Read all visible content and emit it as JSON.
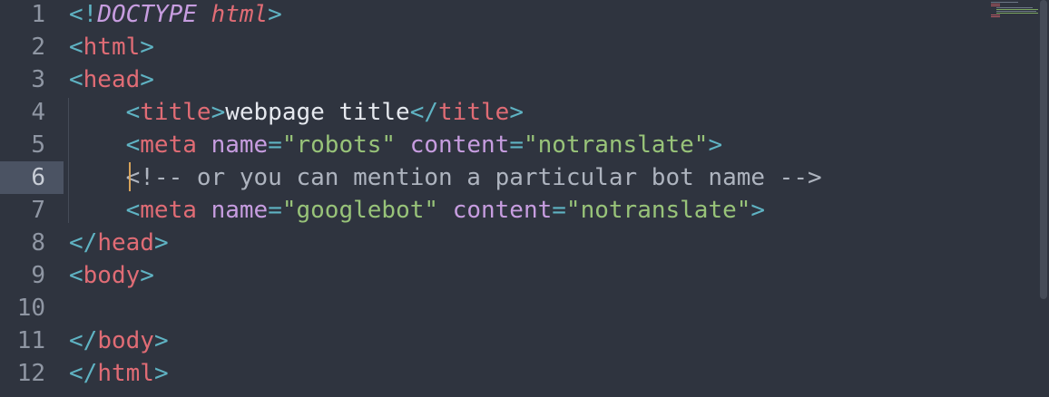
{
  "editor": {
    "active_line": 6,
    "line_numbers": [
      "1",
      "2",
      "3",
      "4",
      "5",
      "6",
      "7",
      "8",
      "9",
      "10",
      "11",
      "12"
    ],
    "colors": {
      "background": "#2f343f",
      "tag": "#e06c75",
      "punctuation": "#5fb3c3",
      "attribute": "#c79de0",
      "string": "#98c379",
      "text": "#e6e9ef",
      "comment": "#aeb4bf",
      "cursor": "#d7a35a"
    },
    "lines": [
      {
        "t1": "<!",
        "t2": "DOCTYPE",
        "t3": " ",
        "t4": "html",
        "t5": ">"
      },
      {
        "t1": "<",
        "t2": "html",
        "t3": ">"
      },
      {
        "t1": "<",
        "t2": "head",
        "t3": ">"
      },
      {
        "indent": "    ",
        "t1": "<",
        "t2": "title",
        "t3": ">",
        "t4": "webpage title",
        "t5": "</",
        "t6": "title",
        "t7": ">"
      },
      {
        "indent": "    ",
        "t1": "<",
        "t2": "meta",
        "t3": " ",
        "t4": "name",
        "t5": "=",
        "t6": "\"robots\"",
        "t7": " ",
        "t8": "content",
        "t9": "=",
        "t10": "\"notranslate\"",
        "t11": ">"
      },
      {
        "indent": "    ",
        "t1": "<!-- or you can mention a particular bot name -->"
      },
      {
        "indent": "    ",
        "t1": "<",
        "t2": "meta",
        "t3": " ",
        "t4": "name",
        "t5": "=",
        "t6": "\"googlebot\"",
        "t7": " ",
        "t8": "content",
        "t9": "=",
        "t10": "\"notranslate\"",
        "t11": ">"
      },
      {
        "t1": "</",
        "t2": "head",
        "t3": ">"
      },
      {
        "t1": "<",
        "t2": "body",
        "t3": ">"
      },
      {},
      {
        "t1": "</",
        "t2": "body",
        "t3": ">"
      },
      {
        "t1": "</",
        "t2": "html",
        "t3": ">"
      }
    ]
  }
}
